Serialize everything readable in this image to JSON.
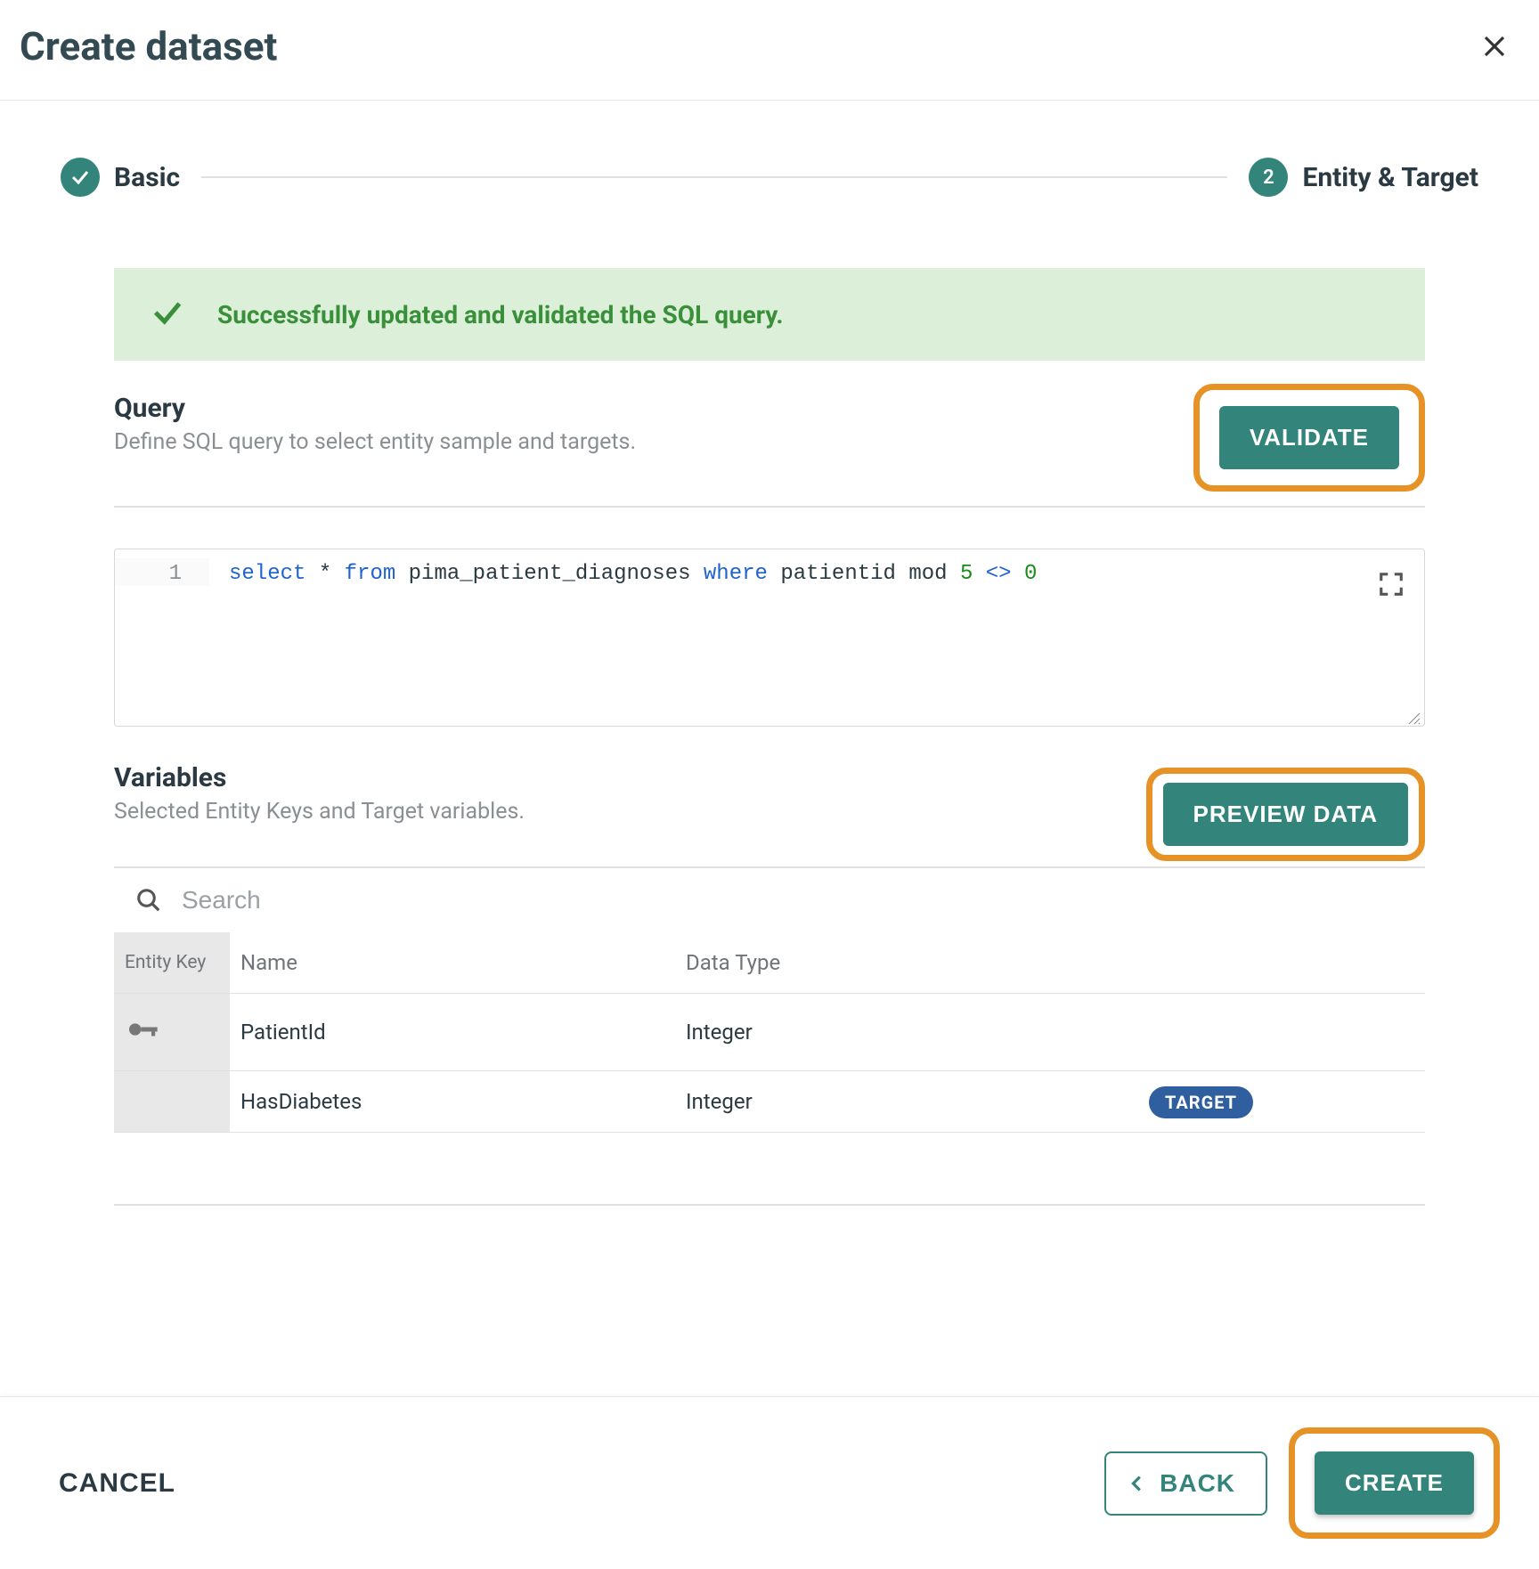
{
  "modal": {
    "title": "Create dataset"
  },
  "stepper": {
    "step1_label": "Basic",
    "step2_number": "2",
    "step2_label": "Entity & Target"
  },
  "alert": {
    "message": "Successfully updated and validated the SQL query."
  },
  "query": {
    "heading": "Query",
    "subheading": "Define SQL query to select entity sample and targets.",
    "validate_label": "VALIDATE",
    "line_number": "1",
    "sql": {
      "kw_select": "select",
      "star": " * ",
      "kw_from": "from",
      "tbl": " pima_patient_diagnoses ",
      "kw_where": "where",
      "col_mod": " patientid mod ",
      "lit_5": "5",
      "op_ne": " <> ",
      "lit_0": "0"
    }
  },
  "variables": {
    "heading": "Variables",
    "subheading": "Selected Entity Keys and Target variables.",
    "preview_label": "PREVIEW DATA",
    "search_placeholder": "Search",
    "table": {
      "col_entitykey": "Entity Key",
      "col_name": "Name",
      "col_type": "Data Type",
      "rows": [
        {
          "name": "PatientId",
          "type": "Integer",
          "is_key": true,
          "is_target": false
        },
        {
          "name": "HasDiabetes",
          "type": "Integer",
          "is_key": false,
          "is_target": true
        }
      ]
    },
    "target_badge": "TARGET"
  },
  "footer": {
    "cancel": "CANCEL",
    "back": "BACK",
    "create": "CREATE"
  },
  "colors": {
    "accent": "#33857b",
    "highlight": "#e69227",
    "success_bg": "#dcefd9",
    "success_fg": "#3a8f3a",
    "target_badge": "#2f5f9e"
  }
}
